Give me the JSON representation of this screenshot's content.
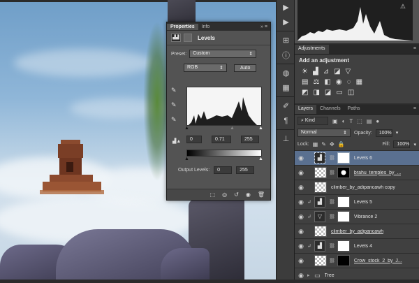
{
  "properties": {
    "tabs": [
      "Properties",
      "Info"
    ],
    "title": "Levels",
    "preset_label": "Preset:",
    "preset_value": "Custom",
    "channel_value": "RGB",
    "auto_label": "Auto",
    "input_black": "0",
    "input_mid": "0.71",
    "input_white": "255",
    "output_label": "Output Levels:",
    "output_black": "0",
    "output_white": "255"
  },
  "adjustments": {
    "tab": "Adjustments",
    "add_label": "Add an adjustment"
  },
  "layers": {
    "tabs": [
      "Layers",
      "Channels",
      "Paths"
    ],
    "kind_label": "Kind",
    "blend_mode": "Normal",
    "opacity_label": "Opacity:",
    "opacity_value": "100%",
    "lock_label": "Lock:",
    "fill_label": "Fill:",
    "fill_value": "100%",
    "items": [
      {
        "name": "Levels 6",
        "type": "adjustment",
        "icon": "levels"
      },
      {
        "name": "brahu_temples_by_...",
        "type": "masked"
      },
      {
        "name": "climber_by_adipancawh copy",
        "type": "pixel"
      },
      {
        "name": "Levels 5",
        "type": "adjustment",
        "icon": "levels"
      },
      {
        "name": "Vibrance 2",
        "type": "adjustment",
        "icon": "vibrance"
      },
      {
        "name": "climber_by_adipancawh",
        "type": "pixel"
      },
      {
        "name": "Levels 4",
        "type": "adjustment",
        "icon": "levels"
      },
      {
        "name": "Crow_stock_2_by_J...",
        "type": "masked"
      },
      {
        "name": "Tree",
        "type": "group"
      }
    ]
  },
  "histogram": {
    "warning": "⚠"
  },
  "colors": {
    "panel_bg": "#404040",
    "selected_row": "#5a7090",
    "accent": "#4a6a9a"
  }
}
